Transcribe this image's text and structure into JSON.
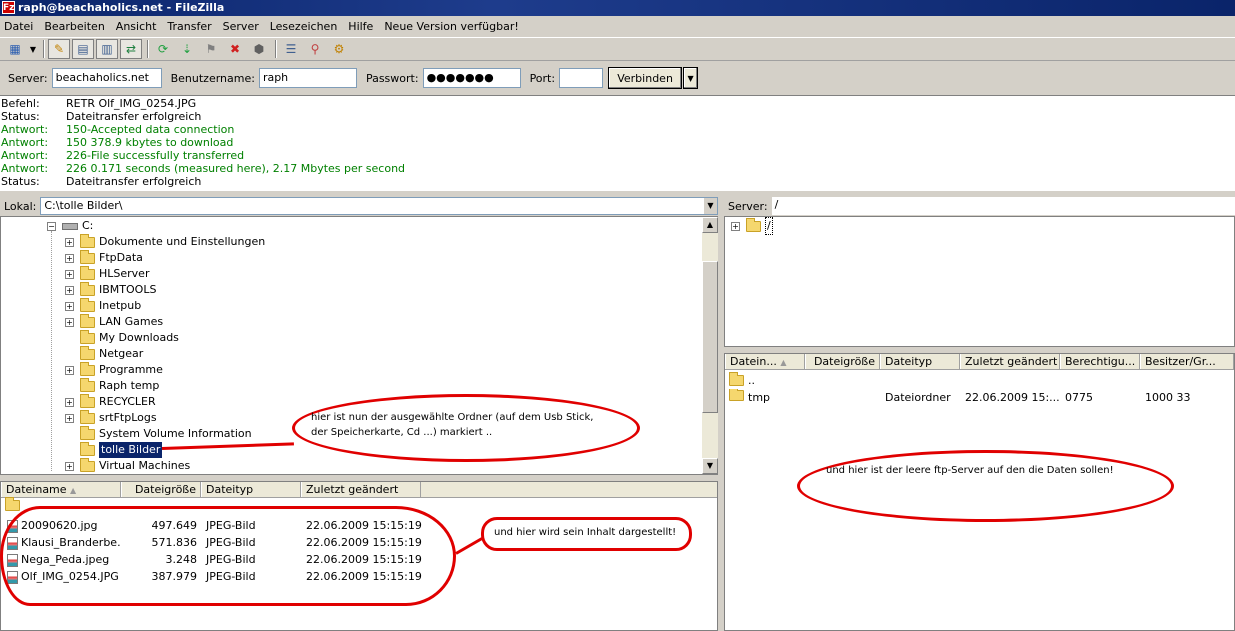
{
  "window": {
    "title": "raph@beachaholics.net - FileZilla",
    "app_icon": "Fz"
  },
  "menu": [
    "Datei",
    "Bearbeiten",
    "Ansicht",
    "Transfer",
    "Server",
    "Lesezeichen",
    "Hilfe",
    "Neue Version verfügbar!"
  ],
  "quickconnect": {
    "server_label": "Server:",
    "server_value": "beachaholics.net",
    "user_label": "Benutzername:",
    "user_value": "raph",
    "pass_label": "Passwort:",
    "pass_value": "●●●●●●●",
    "port_label": "Port:",
    "port_value": "",
    "connect_label": "Verbinden"
  },
  "log": [
    {
      "k": "Befehl:",
      "v": "RETR Olf_IMG_0254.JPG",
      "green": false
    },
    {
      "k": "Status:",
      "v": "Dateitransfer erfolgreich",
      "green": false
    },
    {
      "k": "Antwort:",
      "v": "150-Accepted data connection",
      "green": true
    },
    {
      "k": "Antwort:",
      "v": "150 378.9 kbytes to download",
      "green": true
    },
    {
      "k": "Antwort:",
      "v": "226-File successfully transferred",
      "green": true
    },
    {
      "k": "Antwort:",
      "v": "226 0.171 seconds (measured here), 2.17 Mbytes per second",
      "green": true
    },
    {
      "k": "Status:",
      "v": "Dateitransfer erfolgreich",
      "green": false
    }
  ],
  "local": {
    "label": "Lokal:",
    "path": "C:\\tolle Bilder\\",
    "drive": "C:",
    "tree": [
      {
        "name": "Dokumente und Einstellungen",
        "plus": true
      },
      {
        "name": "FtpData",
        "plus": true
      },
      {
        "name": "HLServer",
        "plus": true
      },
      {
        "name": "IBMTOOLS",
        "plus": true
      },
      {
        "name": "Inetpub",
        "plus": true
      },
      {
        "name": "LAN Games",
        "plus": true
      },
      {
        "name": "My Downloads",
        "plus": false
      },
      {
        "name": "Netgear",
        "plus": false
      },
      {
        "name": "Programme",
        "plus": true
      },
      {
        "name": "Raph temp",
        "plus": false
      },
      {
        "name": "RECYCLER",
        "plus": true
      },
      {
        "name": "srtFtpLogs",
        "plus": true
      },
      {
        "name": "System Volume Information",
        "plus": false
      },
      {
        "name": "tolle Bilder",
        "plus": false,
        "selected": true
      },
      {
        "name": "Virtual Machines",
        "plus": true
      }
    ],
    "columns": [
      "Dateiname",
      "Dateigröße",
      "Dateityp",
      "Zuletzt geändert"
    ],
    "files": [
      {
        "name": "20090620.jpg",
        "size": "497.649",
        "type": "JPEG-Bild",
        "date": "22.06.2009 15:15:19"
      },
      {
        "name": "Klausi_Branderbe...",
        "size": "571.836",
        "type": "JPEG-Bild",
        "date": "22.06.2009 15:15:19"
      },
      {
        "name": "Nega_Peda.jpeg",
        "size": "3.248",
        "type": "JPEG-Bild",
        "date": "22.06.2009 15:15:19"
      },
      {
        "name": "Olf_IMG_0254.JPG",
        "size": "387.979",
        "type": "JPEG-Bild",
        "date": "22.06.2009 15:15:19"
      }
    ]
  },
  "remote": {
    "label": "Server:",
    "path": "/",
    "tree_root": "/",
    "columns": [
      "Datein...",
      "Dateigröße",
      "Dateityp",
      "Zuletzt geändert",
      "Berechtigu...",
      "Besitzer/Gr..."
    ],
    "parent": "..",
    "files": [
      {
        "name": "tmp",
        "size": "",
        "type": "Dateiordner",
        "date": "22.06.2009 15:...",
        "perm": "0775",
        "owner": "1000 33"
      }
    ]
  },
  "annotations": {
    "folder_note_1": "hier ist nun der ausgewählte Ordner (auf dem Usb Stick,",
    "folder_note_2": "der Speicherkarte, Cd ...) markiert ..",
    "content_note": "und hier wird sein Inhalt dargestellt!",
    "server_note": "und hier ist der leere ftp-Server auf den die Daten sollen!",
    "color": "#e00000"
  }
}
